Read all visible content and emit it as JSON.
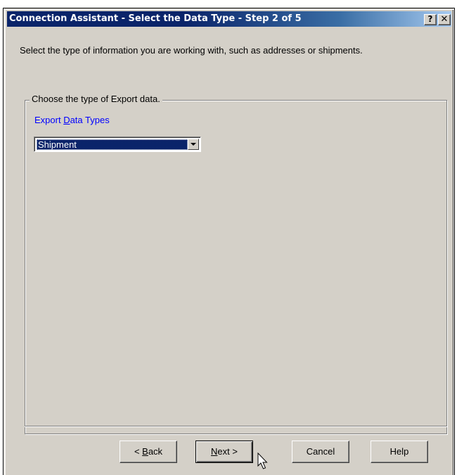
{
  "window": {
    "title": "Connection Assistant - Select the Data Type - Step 2 of 5",
    "help_label": "?",
    "close_label": "✕"
  },
  "intro_text": "Select the type of information you are working with, such as addresses or shipments.",
  "group": {
    "legend": "Choose the type of Export data.",
    "field_label_prefix": "Export ",
    "field_label_accel": "D",
    "field_label_suffix": "ata Types",
    "selected_value": "Shipment"
  },
  "buttons": {
    "back_prefix": "< ",
    "back_accel": "B",
    "back_suffix": "ack",
    "next_accel": "N",
    "next_suffix": "ext >",
    "cancel": "Cancel",
    "help": "Help"
  },
  "icons": {
    "cursor": "arrow-cursor-icon",
    "dropdown": "chevron-down-icon"
  },
  "colors": {
    "title_bar": "#0a246a",
    "face": "#d4d0c8",
    "label_blue": "#0000ff",
    "selection": "#0a246a"
  }
}
